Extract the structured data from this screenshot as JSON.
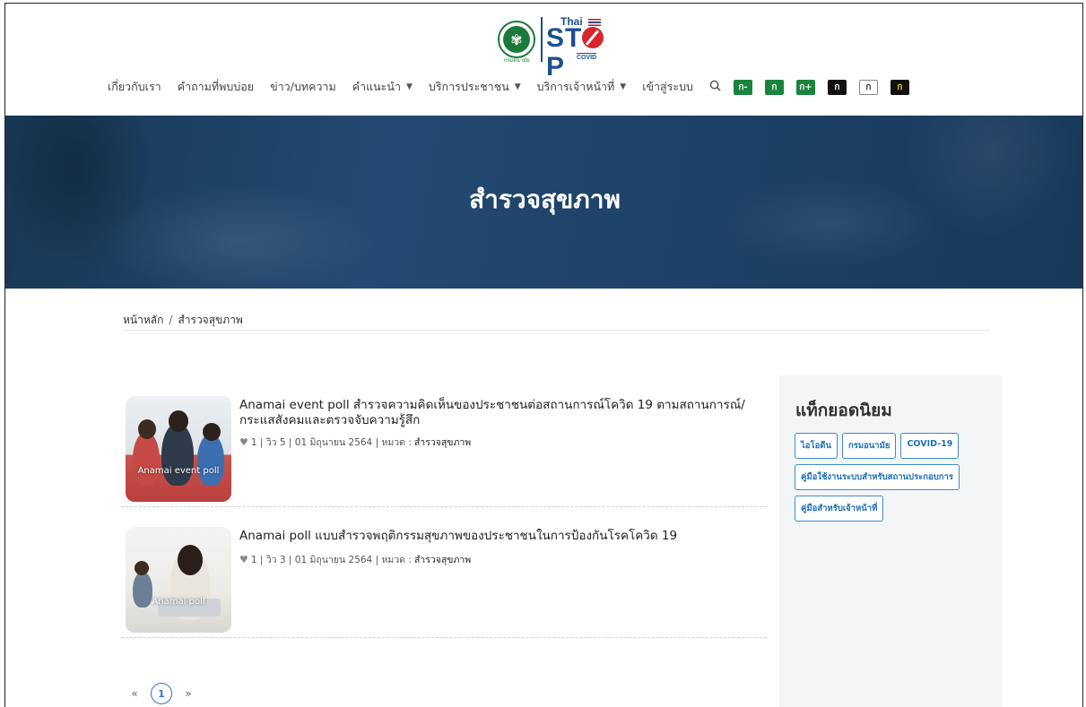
{
  "logo": {
    "seal_text": "กรมอนามัย",
    "brand_top": "Thai",
    "brand_main_left": "ST",
    "brand_main_right": "P",
    "brand_sub": "COVID"
  },
  "nav": {
    "items": [
      {
        "label": "เกี่ยวกับเรา",
        "dropdown": false
      },
      {
        "label": "คำถามที่พบบ่อย",
        "dropdown": false
      },
      {
        "label": "ข่าว/บทความ",
        "dropdown": false
      },
      {
        "label": "คำแนะนำ",
        "dropdown": true
      },
      {
        "label": "บริการประชาชน",
        "dropdown": true
      },
      {
        "label": "บริการเจ้าหน้าที่",
        "dropdown": true
      },
      {
        "label": "เข้าสู่ระบบ",
        "dropdown": false
      }
    ],
    "search_icon": "search-icon",
    "font_buttons": [
      "ก-",
      "ก",
      "ก+",
      "ก",
      "ก",
      "ก"
    ]
  },
  "banner": {
    "title": "สำรวจสุขภาพ"
  },
  "breadcrumb": {
    "home": "หน้าหลัก",
    "separator": "/",
    "current": "สำรวจสุขภาพ"
  },
  "posts": [
    {
      "title": "Anamai event poll สำรวจความคิดเห็นของประชาชนต่อสถานการณ์โควิด 19 ตามสถานการณ์/กระแสสังคมและตรวจจับความรู้สึก",
      "thumb_caption": "Anamai event poll",
      "meta": "1 | วิว 5 | 01 มิถุนายน 2564 | หมวด :",
      "category": "สำรวจสุขภาพ"
    },
    {
      "title": "Anamai poll แบบสำรวจพฤติกรรมสุขภาพของประชาชนในการป้องกันโรคโควิด 19",
      "thumb_caption": "Anamai poll",
      "meta": "1 | วิว 3 | 01 มิถุนายน 2564 | หมวด :",
      "category": "สำรวจสุขภาพ"
    }
  ],
  "pagination": {
    "prev": "«",
    "current": "1",
    "next": "»"
  },
  "sidebar": {
    "title": "แท็กยอดนิยม",
    "tags": [
      "ไอโอดีน",
      "กรมอนามัย",
      "COVID-19",
      "คู่มือใช้งานระบบสำหรับสถานประกอบการ",
      "คู่มือสำหรับเจ้าหน้าที่"
    ]
  }
}
